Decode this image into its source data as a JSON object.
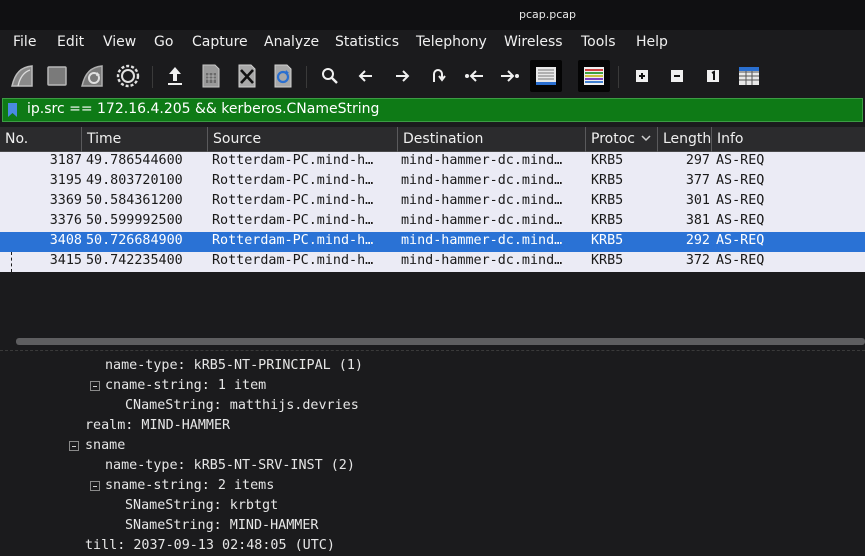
{
  "window": {
    "title": "pcap.pcap"
  },
  "menu": [
    "File",
    "Edit",
    "View",
    "Go",
    "Capture",
    "Analyze",
    "Statistics",
    "Telephony",
    "Wireless",
    "Tools",
    "Help"
  ],
  "toolbar": {
    "buttons": [
      "start-capture-icon",
      "stop-capture-icon",
      "restart-capture-icon",
      "capture-options-icon",
      "open-file-icon",
      "save-file-icon",
      "close-file-icon",
      "reload-file-icon",
      "find-packet-icon",
      "go-back-icon",
      "go-forward-icon",
      "go-to-packet-icon",
      "first-packet-icon",
      "last-packet-icon",
      "autoscroll-icon",
      "colorize-icon",
      "zoom-in-icon",
      "zoom-out-icon",
      "normal-size-icon",
      "resize-columns-icon"
    ]
  },
  "filter": {
    "value": "ip.src == 172.16.4.205 && kerberos.CNameString"
  },
  "columns": [
    "No.",
    "Time",
    "Source",
    "Destination",
    "Protoc",
    "Length",
    "Info"
  ],
  "packets": [
    {
      "no": "3187",
      "time": "49.786544600",
      "source": "Rotterdam-PC.mind-h…",
      "destination": "mind-hammer-dc.mind…",
      "protocol": "KRB5",
      "length": "297",
      "info": "AS-REQ"
    },
    {
      "no": "3195",
      "time": "49.803720100",
      "source": "Rotterdam-PC.mind-h…",
      "destination": "mind-hammer-dc.mind…",
      "protocol": "KRB5",
      "length": "377",
      "info": "AS-REQ"
    },
    {
      "no": "3369",
      "time": "50.584361200",
      "source": "Rotterdam-PC.mind-h…",
      "destination": "mind-hammer-dc.mind…",
      "protocol": "KRB5",
      "length": "301",
      "info": "AS-REQ"
    },
    {
      "no": "3376",
      "time": "50.599992500",
      "source": "Rotterdam-PC.mind-h…",
      "destination": "mind-hammer-dc.mind…",
      "protocol": "KRB5",
      "length": "381",
      "info": "AS-REQ"
    },
    {
      "no": "3408",
      "time": "50.726684900",
      "source": "Rotterdam-PC.mind-h…",
      "destination": "mind-hammer-dc.mind…",
      "protocol": "KRB5",
      "length": "292",
      "info": "AS-REQ"
    },
    {
      "no": "3415",
      "time": "50.742235400",
      "source": "Rotterdam-PC.mind-h…",
      "destination": "mind-hammer-dc.mind…",
      "protocol": "KRB5",
      "length": "372",
      "info": "AS-REQ"
    }
  ],
  "details": [
    "name-type: kRB5-NT-PRINCIPAL (1)",
    "cname-string: 1 item",
    "CNameString: matthijs.devries",
    "realm: MIND-HAMMER",
    "sname",
    "name-type: kRB5-NT-SRV-INST (2)",
    "sname-string: 2 items",
    "SNameString: krbtgt",
    "SNameString: MIND-HAMMER",
    "till: 2037-09-13 02:48:05 (UTC)"
  ],
  "colors": {
    "filter_valid": "#0e7a16",
    "selected_row": "#2a72d5",
    "row_bg": "#ebebf5",
    "bg": "#1b1b1d"
  }
}
